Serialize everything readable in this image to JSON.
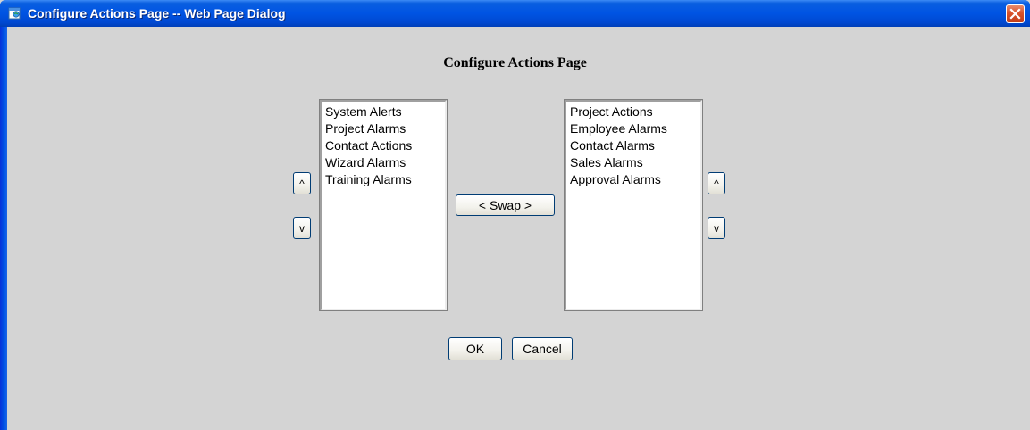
{
  "window": {
    "title": "Configure Actions Page -- Web Page Dialog"
  },
  "page": {
    "heading": "Configure Actions Page"
  },
  "left_list": {
    "items": [
      "System Alerts",
      "Project Alarms",
      "Contact Actions",
      "Wizard Alarms",
      "Training Alarms"
    ],
    "up_label": "^",
    "down_label": "v"
  },
  "right_list": {
    "items": [
      "Project Actions",
      "Employee Alarms",
      "Contact Alarms",
      "Sales Alarms",
      "Approval Alarms"
    ],
    "up_label": "^",
    "down_label": "v"
  },
  "buttons": {
    "swap_label": "< Swap >",
    "ok_label": "OK",
    "cancel_label": "Cancel"
  },
  "icons": {
    "app": "web-page-dialog-icon",
    "close": "close-icon"
  },
  "colors": {
    "titlebar": "#0054e3",
    "dialog_background": "#d4d4d4",
    "close_button": "#d9532c"
  }
}
